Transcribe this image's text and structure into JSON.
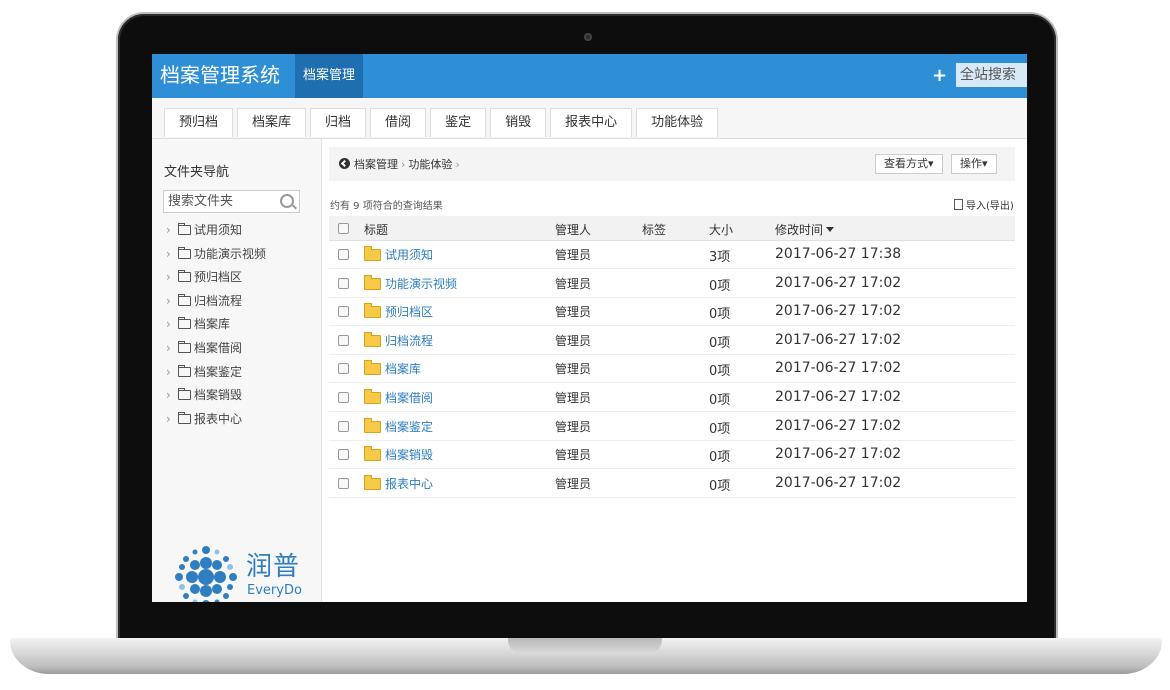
{
  "app": {
    "title": "档案管理系统",
    "active_tab": "档案管理",
    "add_symbol": "+",
    "site_search": "全站搜索"
  },
  "tabs": [
    "预归档",
    "档案库",
    "归档",
    "借阅",
    "鉴定",
    "销毁",
    "报表中心",
    "功能体验"
  ],
  "sidebar": {
    "title": "文件夹导航",
    "search_placeholder": "搜索文件夹",
    "folders": [
      "试用须知",
      "功能演示视频",
      "预归档区",
      "归档流程",
      "档案库",
      "档案借阅",
      "档案鉴定",
      "档案销毁",
      "报表中心"
    ]
  },
  "logo": {
    "cn": "润普",
    "en": "EveryDo",
    "color": "#2e7ec1"
  },
  "breadcrumb": {
    "items": [
      "档案管理",
      "功能体验"
    ]
  },
  "toolbar": {
    "view_label": "查看方式▾",
    "ops_label": "操作▾"
  },
  "results": {
    "summary": "约有 9 项符合的查询结果",
    "import_export": "导入(导出)"
  },
  "table": {
    "headers": {
      "title": "标题",
      "manager": "管理人",
      "tags": "标签",
      "size": "大小",
      "modified": "修改时间"
    },
    "rows": [
      {
        "title": "试用须知",
        "manager": "管理员",
        "tags": "",
        "size": "3项",
        "modified": "2017-06-27 17:38"
      },
      {
        "title": "功能演示视频",
        "manager": "管理员",
        "tags": "",
        "size": "0项",
        "modified": "2017-06-27 17:02"
      },
      {
        "title": "预归档区",
        "manager": "管理员",
        "tags": "",
        "size": "0项",
        "modified": "2017-06-27 17:02"
      },
      {
        "title": "归档流程",
        "manager": "管理员",
        "tags": "",
        "size": "0项",
        "modified": "2017-06-27 17:02"
      },
      {
        "title": "档案库",
        "manager": "管理员",
        "tags": "",
        "size": "0项",
        "modified": "2017-06-27 17:02"
      },
      {
        "title": "档案借阅",
        "manager": "管理员",
        "tags": "",
        "size": "0项",
        "modified": "2017-06-27 17:02"
      },
      {
        "title": "档案鉴定",
        "manager": "管理员",
        "tags": "",
        "size": "0项",
        "modified": "2017-06-27 17:02"
      },
      {
        "title": "档案销毁",
        "manager": "管理员",
        "tags": "",
        "size": "0项",
        "modified": "2017-06-27 17:02"
      },
      {
        "title": "报表中心",
        "manager": "管理员",
        "tags": "",
        "size": "0项",
        "modified": "2017-06-27 17:02"
      }
    ]
  },
  "colors": {
    "topbar": "#2e8fd6",
    "active_tab": "#1f6fb0",
    "link": "#2e7ec1"
  }
}
